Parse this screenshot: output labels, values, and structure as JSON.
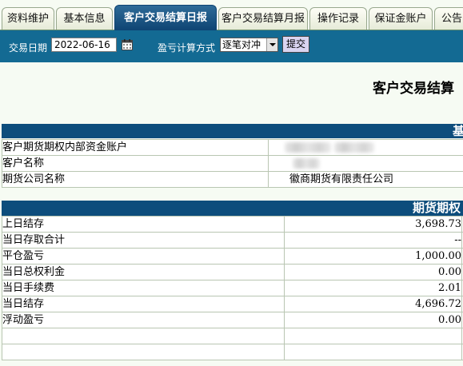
{
  "tabs": [
    {
      "label": "资料维护"
    },
    {
      "label": "基本信息"
    },
    {
      "label": "客户交易结算日报"
    },
    {
      "label": "客户交易结算月报"
    },
    {
      "label": "操作记录"
    },
    {
      "label": "保证金账户"
    },
    {
      "label": "公告"
    }
  ],
  "toolbar": {
    "date_label": "交易日期",
    "date_value": "2022-06-16",
    "calc_label": "盈亏计算方式",
    "calc_selected": "逐笔对冲",
    "submit_label": "提交"
  },
  "report_title": "客户交易结算",
  "basic_section": {
    "header": "基",
    "rows": [
      {
        "label": "客户期货期权内部资金账户",
        "value": ""
      },
      {
        "label": "客户名称",
        "value": ""
      },
      {
        "label": "期货公司名称",
        "value": "徽商期货有限责任公司"
      }
    ]
  },
  "funds_section": {
    "header": "期货期权",
    "rows": [
      {
        "label": "上日结存",
        "value": "3,698.73"
      },
      {
        "label": "当日存取合计",
        "value": "--"
      },
      {
        "label": "平仓盈亏",
        "value": "1,000.00"
      },
      {
        "label": "当日总权利金",
        "value": "0.00"
      },
      {
        "label": "当日手续费",
        "value": "2.01"
      },
      {
        "label": "当日结存",
        "value": "4,696.72"
      },
      {
        "label": "浮动盈亏",
        "value": "0.00"
      },
      {
        "label": "",
        "value": ""
      },
      {
        "label": "",
        "value": ""
      }
    ]
  },
  "colors": {
    "toolbar_bg": "#136a93",
    "section_header_bg": "#0d4d7c",
    "active_tab_bg": "#0f4473",
    "page_bg": "#f6fbf3"
  },
  "icons": {
    "calendar": "calendar-icon",
    "dropdown": "chevron-down-icon"
  }
}
